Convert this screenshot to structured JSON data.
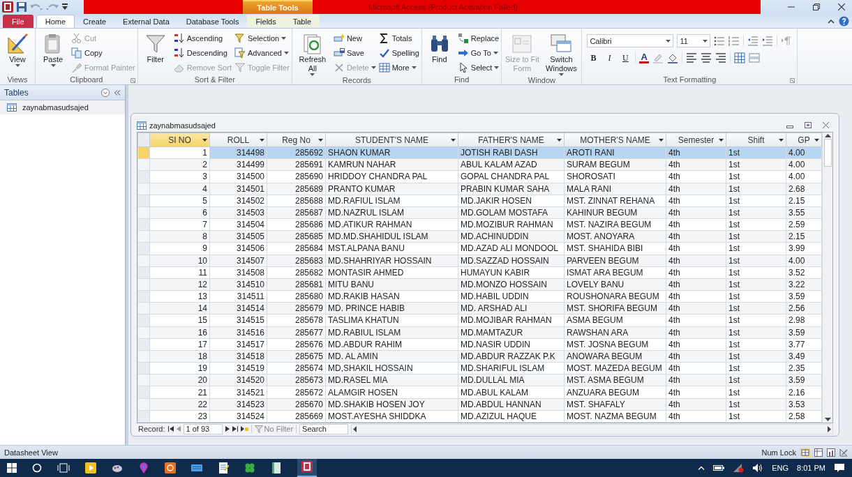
{
  "title_bar": {
    "context_label": "Table Tools",
    "title": "Microsoft Access (Product Activation Failed)"
  },
  "tabs": [
    {
      "label": "File",
      "kind": "file",
      "selected": false
    },
    {
      "label": "Home",
      "kind": "normal",
      "selected": true
    },
    {
      "label": "Create",
      "kind": "normal",
      "selected": false
    },
    {
      "label": "External Data",
      "kind": "normal",
      "selected": false
    },
    {
      "label": "Database Tools",
      "kind": "normal",
      "selected": false
    },
    {
      "label": "Fields",
      "kind": "context",
      "selected": false
    },
    {
      "label": "Table",
      "kind": "context",
      "selected": false
    }
  ],
  "ribbon": {
    "groups": [
      {
        "label": "Views",
        "kind": "buttons",
        "launcher": false,
        "columns": [
          {
            "kind": "large",
            "items": [
              {
                "label": "View",
                "dropdown": true,
                "disabled": false
              }
            ]
          }
        ]
      },
      {
        "label": "Clipboard",
        "kind": "buttons",
        "launcher": true,
        "columns": [
          {
            "kind": "large",
            "items": [
              {
                "label": "Paste",
                "dropdown": true,
                "disabled": false
              }
            ]
          },
          {
            "kind": "small",
            "items": [
              {
                "label": "Cut",
                "dropdown": false,
                "disabled": true
              },
              {
                "label": "Copy",
                "dropdown": false,
                "disabled": false
              },
              {
                "label": "Format Painter",
                "dropdown": false,
                "disabled": true
              }
            ]
          }
        ]
      },
      {
        "label": "Sort & Filter",
        "kind": "buttons",
        "launcher": false,
        "columns": [
          {
            "kind": "large",
            "items": [
              {
                "label": "Filter",
                "dropdown": false,
                "disabled": false
              }
            ]
          },
          {
            "kind": "small",
            "items": [
              {
                "label": "Ascending",
                "dropdown": false,
                "disabled": false
              },
              {
                "label": "Descending",
                "dropdown": false,
                "disabled": false
              },
              {
                "label": "Remove Sort",
                "dropdown": false,
                "disabled": true
              }
            ]
          },
          {
            "kind": "small",
            "items": [
              {
                "label": "Selection",
                "dropdown": true,
                "disabled": false
              },
              {
                "label": "Advanced",
                "dropdown": true,
                "disabled": false
              },
              {
                "label": "Toggle Filter",
                "dropdown": false,
                "disabled": true
              }
            ]
          }
        ]
      },
      {
        "label": "Records",
        "kind": "buttons",
        "launcher": false,
        "columns": [
          {
            "kind": "large",
            "items": [
              {
                "label": "Refresh All",
                "dropdown": true,
                "disabled": false
              }
            ]
          },
          {
            "kind": "small",
            "items": [
              {
                "label": "New",
                "dropdown": false,
                "disabled": false
              },
              {
                "label": "Save",
                "dropdown": false,
                "disabled": false
              },
              {
                "label": "Delete",
                "dropdown": true,
                "disabled": true
              }
            ]
          },
          {
            "kind": "small",
            "items": [
              {
                "label": "Totals",
                "dropdown": false,
                "disabled": false
              },
              {
                "label": "Spelling",
                "dropdown": false,
                "disabled": false
              },
              {
                "label": "More",
                "dropdown": true,
                "disabled": false
              }
            ]
          }
        ]
      },
      {
        "label": "Find",
        "kind": "buttons",
        "launcher": false,
        "columns": [
          {
            "kind": "large",
            "items": [
              {
                "label": "Find",
                "dropdown": false,
                "disabled": false
              }
            ]
          },
          {
            "kind": "small",
            "items": [
              {
                "label": "Replace",
                "dropdown": false,
                "disabled": false
              },
              {
                "label": "Go To",
                "dropdown": true,
                "disabled": false
              },
              {
                "label": "Select",
                "dropdown": true,
                "disabled": false
              }
            ]
          }
        ]
      },
      {
        "label": "Window",
        "kind": "buttons",
        "launcher": false,
        "columns": [
          {
            "kind": "large",
            "items": [
              {
                "label": "Size to Fit Form",
                "dropdown": false,
                "disabled": true
              }
            ]
          },
          {
            "kind": "large",
            "items": [
              {
                "label": "Switch Windows",
                "dropdown": true,
                "disabled": false
              }
            ]
          }
        ]
      },
      {
        "label": "Text Formatting",
        "kind": "format",
        "launcher": true,
        "font": "Calibri",
        "size": "11",
        "styles": [
          {
            "label": "B",
            "kind": "bold"
          },
          {
            "label": "I",
            "kind": "italic"
          },
          {
            "label": "U",
            "kind": "underline"
          }
        ],
        "font_color": "A"
      }
    ]
  },
  "nav_pane": {
    "header": "Tables",
    "items": [
      {
        "label": "zaynabmasudsajed",
        "selected": true
      }
    ]
  },
  "document": {
    "title": "zaynabmasudsajed",
    "columns": [
      {
        "label": "SI NO",
        "kind": "number",
        "active": true
      },
      {
        "label": "ROLL",
        "kind": "number",
        "active": false
      },
      {
        "label": "Reg No",
        "kind": "number",
        "active": false
      },
      {
        "label": "STUDENT'S NAME",
        "kind": "text",
        "active": false
      },
      {
        "label": "FATHER'S NAME",
        "kind": "text",
        "active": false
      },
      {
        "label": "MOTHER'S NAME",
        "kind": "text",
        "active": false
      },
      {
        "label": "Semester",
        "kind": "text",
        "active": false
      },
      {
        "label": "Shift",
        "kind": "text",
        "active": false
      },
      {
        "label": "GP",
        "kind": "text",
        "active": false
      }
    ],
    "rows": [
      {
        "selected": true,
        "cells": [
          "1",
          "314498",
          "285692",
          "SHAON KUMAR",
          "JOTISH RABI DASH",
          "AROTI RANI",
          "4th",
          "1st",
          "4.00"
        ]
      },
      {
        "selected": false,
        "cells": [
          "2",
          "314499",
          "285691",
          "KAMRUN NAHAR",
          "ABUL KALAM AZAD",
          "SURAM BEGUM",
          "4th",
          "1st",
          "4.00"
        ]
      },
      {
        "selected": false,
        "cells": [
          "3",
          "314500",
          "285690",
          "HRIDDOY CHANDRA PAL",
          "GOPAL CHANDRA PAL",
          "SHOROSATI",
          "4th",
          "1st",
          "4.00"
        ]
      },
      {
        "selected": false,
        "cells": [
          "4",
          "314501",
          "285689",
          "PRANTO KUMAR",
          "PRABIN KUMAR SAHA",
          "MALA RANI",
          "4th",
          "1st",
          "2.68"
        ]
      },
      {
        "selected": false,
        "cells": [
          "5",
          "314502",
          "285688",
          "MD.RAFIUL ISLAM",
          "MD.JAKIR HOSEN",
          "MST. ZINNAT REHANA",
          "4th",
          "1st",
          "2.15"
        ]
      },
      {
        "selected": false,
        "cells": [
          "6",
          "314503",
          "285687",
          "MD.NAZRUL ISLAM",
          "MD.GOLAM MOSTAFA",
          "KAHINUR BEGUM",
          "4th",
          "1st",
          "3.55"
        ]
      },
      {
        "selected": false,
        "cells": [
          "7",
          "314504",
          "285686",
          "MD.ATIKUR RAHMAN",
          "MD.MOZIBUR RAHMAN",
          "MST. NAZIRA BEGUM",
          "4th",
          "1st",
          "2.59"
        ]
      },
      {
        "selected": false,
        "cells": [
          "8",
          "314505",
          "285685",
          "MD.MD.SHAHIDUL ISLAM",
          "MD.ACHINUDDIN",
          "MOST. ANOYARA",
          "4th",
          "1st",
          "2.15"
        ]
      },
      {
        "selected": false,
        "cells": [
          "9",
          "314506",
          "285684",
          "MST.ALPANA BANU",
          "MD.AZAD ALI MONDOOL",
          "MST. SHAHIDA BIBI",
          "4th",
          "1st",
          "3.99"
        ]
      },
      {
        "selected": false,
        "cells": [
          "10",
          "314507",
          "285683",
          "MD.SHAHRIYAR HOSSAIN",
          "MD.SAZZAD HOSSAIN",
          "PARVEEN BEGUM",
          "4th",
          "1st",
          "4.00"
        ]
      },
      {
        "selected": false,
        "cells": [
          "11",
          "314508",
          "285682",
          "MONTASIR AHMED",
          "HUMAYUN KABIR",
          "ISMAT ARA BEGUM",
          "4th",
          "1st",
          "3.52"
        ]
      },
      {
        "selected": false,
        "cells": [
          "12",
          "314510",
          "285681",
          "MITU BANU",
          "MD.MONZO HOSSAIN",
          "LOVELY BANU",
          "4th",
          "1st",
          "3.22"
        ]
      },
      {
        "selected": false,
        "cells": [
          "13",
          "314511",
          "285680",
          "MD.RAKIB HASAN",
          "MD.HABIL UDDIN",
          "ROUSHONARA BEGUM",
          "4th",
          "1st",
          "3.59"
        ]
      },
      {
        "selected": false,
        "cells": [
          "14",
          "314514",
          "285679",
          "MD. PRINCE HABIB",
          "MD. ARSHAD ALI",
          "MST. SHORIFA BEGUM",
          "4th",
          "1st",
          "2.56"
        ]
      },
      {
        "selected": false,
        "cells": [
          "15",
          "314515",
          "285678",
          "TASLIMA KHATUN",
          "MD.MOJIBAR RAHMAN",
          "ASMA BEGUM",
          "4th",
          "1st",
          "2.98"
        ]
      },
      {
        "selected": false,
        "cells": [
          "16",
          "314516",
          "285677",
          "MD.RABIUL ISLAM",
          "MD.MAMTAZUR",
          "RAWSHAN ARA",
          "4th",
          "1st",
          "3.59"
        ]
      },
      {
        "selected": false,
        "cells": [
          "17",
          "314517",
          "285676",
          "MD.ABDUR RAHIM",
          "MD.NASIR UDDIN",
          "MST. JOSNA BEGUM",
          "4th",
          "1st",
          "3.77"
        ]
      },
      {
        "selected": false,
        "cells": [
          "18",
          "314518",
          "285675",
          "MD. AL AMIN",
          "MD.ABDUR RAZZAK P.K",
          "ANOWARA BEGUM",
          "4th",
          "1st",
          "3.49"
        ]
      },
      {
        "selected": false,
        "cells": [
          "19",
          "314519",
          "285674",
          "MD,SHAKIL HOSSAIN",
          "MD.SHARIFUL ISLAM",
          "MOST. MAZEDA BEGUM",
          "4th",
          "1st",
          "2.35"
        ]
      },
      {
        "selected": false,
        "cells": [
          "20",
          "314520",
          "285673",
          "MD.RASEL MIA",
          "MD.DULLAL MIA",
          "MST. ASMA BEGUM",
          "4th",
          "1st",
          "3.59"
        ]
      },
      {
        "selected": false,
        "cells": [
          "21",
          "314521",
          "285672",
          "ALAMGIR HOSEN",
          "MD.ABUL KALAM",
          "ANZUARA BEGUM",
          "4th",
          "1st",
          "2.16"
        ]
      },
      {
        "selected": false,
        "cells": [
          "22",
          "314523",
          "285670",
          "MD.SHAKIB HOSEN JOY",
          "MD.ABDUL HANNAN",
          "MST. SHAFALY",
          "4th",
          "1st",
          "3.53"
        ]
      },
      {
        "selected": false,
        "cells": [
          "23",
          "314524",
          "285669",
          "MOST.AYESHA SHIDDKA",
          "MD.AZIZUL HAQUE",
          "MOST. NAZMA BEGUM",
          "4th",
          "1st",
          "2.58"
        ]
      }
    ],
    "record_nav": {
      "label": "Record:",
      "position": "1 of 93",
      "filter": "No Filter",
      "search_placeholder": "Search"
    }
  },
  "status_bar": {
    "left": "Datasheet View",
    "right": "Num Lock"
  },
  "taskbar": {
    "language": "ENG",
    "time": "8:01 PM"
  }
}
